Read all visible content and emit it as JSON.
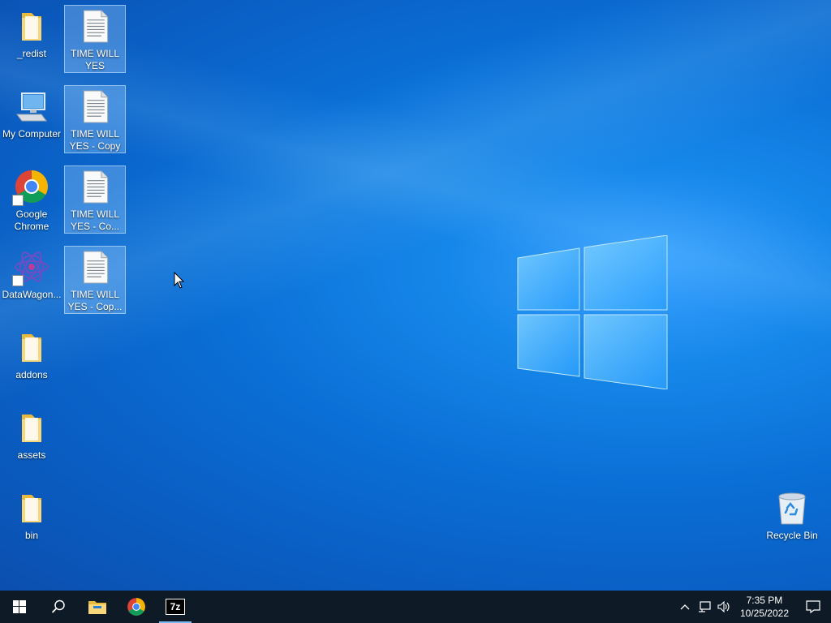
{
  "desktop": {
    "left_column": [
      {
        "label": "_redist",
        "type": "folder"
      },
      {
        "label": "My Computer",
        "type": "computer"
      },
      {
        "label": "Google Chrome",
        "type": "chrome-shortcut"
      },
      {
        "label": "DataWagon...",
        "type": "datawagon-shortcut"
      },
      {
        "label": "addons",
        "type": "folder"
      },
      {
        "label": "assets",
        "type": "folder"
      },
      {
        "label": "bin",
        "type": "folder"
      }
    ],
    "second_column": [
      {
        "label": "TIME WILL YES",
        "type": "text-file",
        "selected": true
      },
      {
        "label": "TIME WILL YES - Copy",
        "type": "text-file",
        "selected": true
      },
      {
        "label": "TIME WILL YES - Co...",
        "type": "text-file",
        "selected": true
      },
      {
        "label": "TIME WILL YES - Cop...",
        "type": "text-file",
        "selected": true
      }
    ],
    "recycle_bin": {
      "label": "Recycle Bin",
      "type": "recycle-bin"
    }
  },
  "taskbar": {
    "items": [
      "start-icon",
      "search-icon",
      "file-explorer-icon",
      "chrome-icon",
      "7zip-icon"
    ],
    "seven_zip_label": "7z",
    "clock": {
      "time": "7:35 PM",
      "date": "10/25/2022"
    }
  },
  "colors": {
    "taskbar": "#0e1a26",
    "desktop_accent": "#0a6fd6"
  }
}
